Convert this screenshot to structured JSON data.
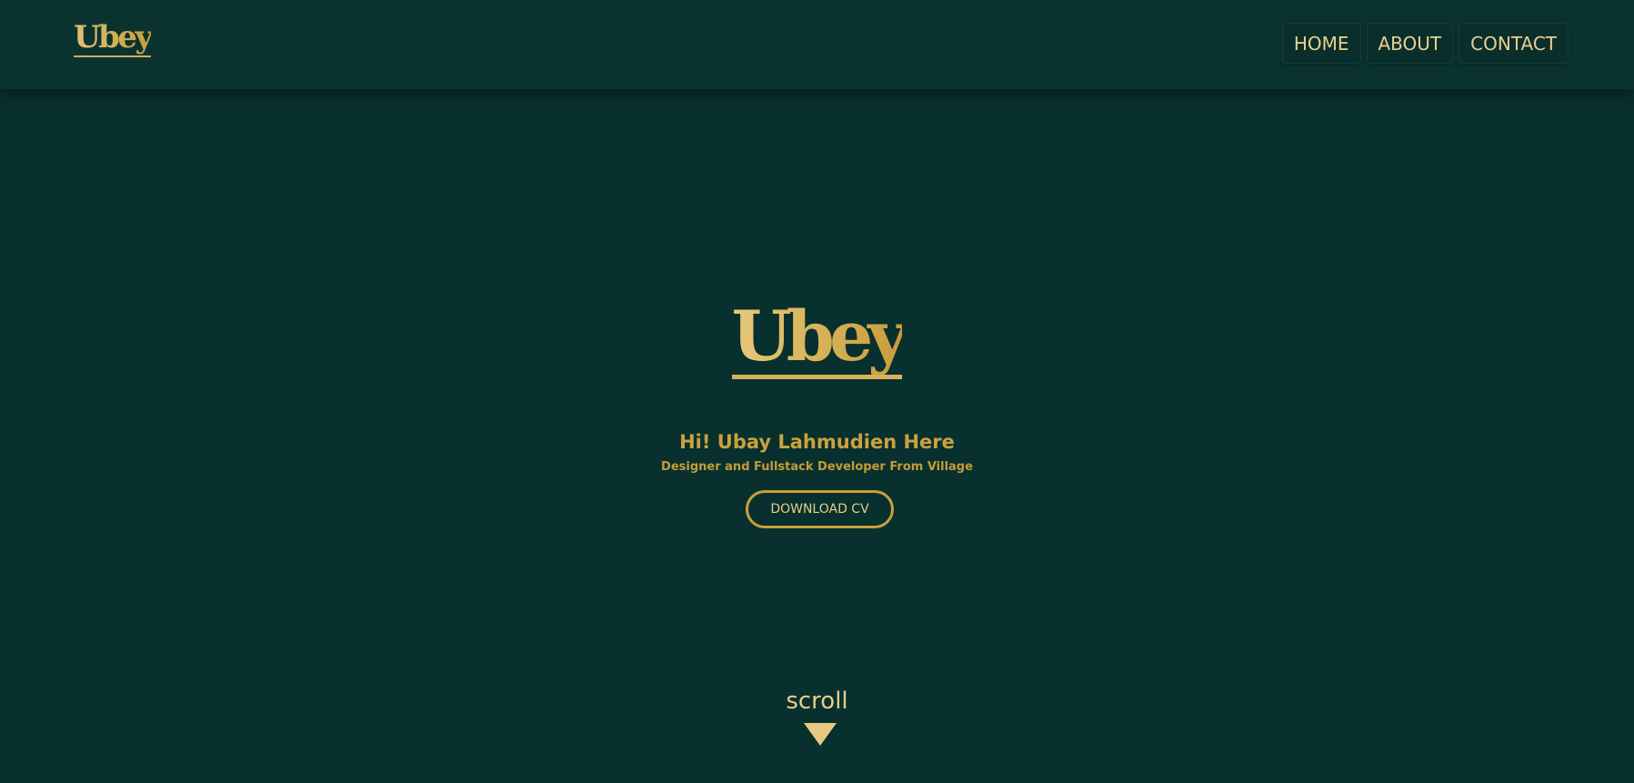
{
  "nav": {
    "logo": "Ubey",
    "links": [
      {
        "label": "HOME"
      },
      {
        "label": "ABOUT"
      },
      {
        "label": "CONTACT"
      }
    ]
  },
  "hero": {
    "logo": "Ubey",
    "headline": "Hi! Ubay Lahmudien Here",
    "subline": "Designer and Fullstack Developer From Village",
    "cv_button": "DOWNLOAD CV"
  },
  "scroll": {
    "label": "scroll",
    "icon": "triangle-down-icon"
  },
  "colors": {
    "background": "#08302e",
    "gold": "#c9a03d",
    "light_gold": "#e7cd8a"
  }
}
